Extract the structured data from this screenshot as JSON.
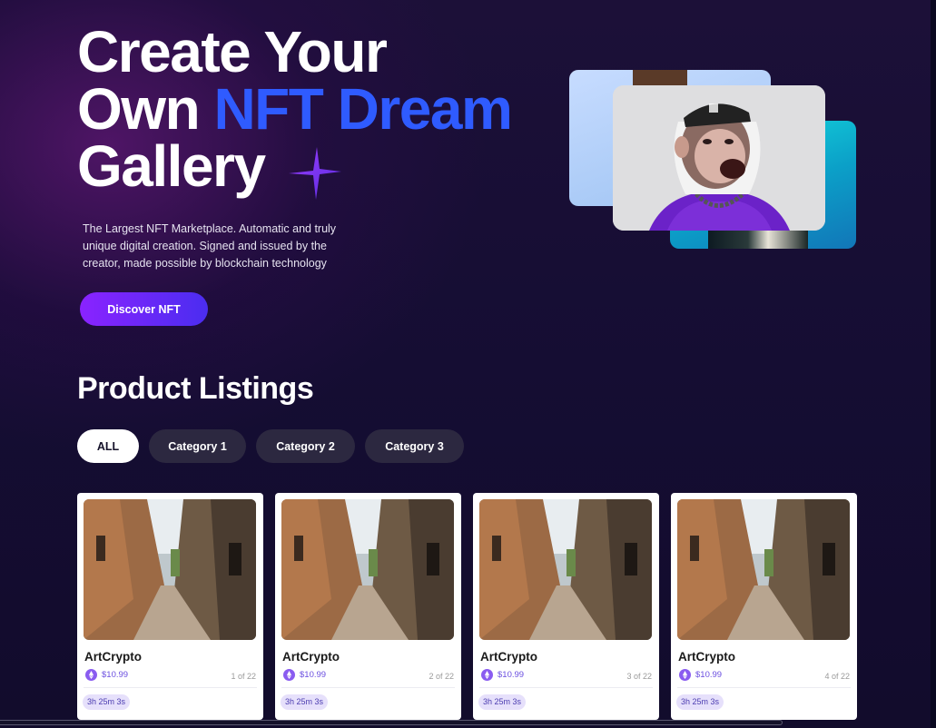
{
  "hero": {
    "title_line1": "Create Your",
    "title_line2_a": "Own ",
    "title_line2_b": "NFT Dream",
    "title_line3": "Gallery",
    "description": "The Largest NFT Marketplace. Automatic and truly unique digital creation. Signed and issued by the creator, made possible by blockchain technology",
    "cta_label": "Discover NFT",
    "sparkle_icon": "sparkle-icon",
    "artwork": "ape-nft-artwork"
  },
  "listings": {
    "title": "Product Listings",
    "filters": [
      {
        "label": "ALL",
        "active": true
      },
      {
        "label": "Category 1",
        "active": false
      },
      {
        "label": "Category 2",
        "active": false
      },
      {
        "label": "Category 3",
        "active": false
      }
    ],
    "cards": [
      {
        "name": "ArtCrypto",
        "price": "$10.99",
        "count": "1 of 22",
        "timer": "3h 25m 3s"
      },
      {
        "name": "ArtCrypto",
        "price": "$10.99",
        "count": "2 of 22",
        "timer": "3h 25m 3s"
      },
      {
        "name": "ArtCrypto",
        "price": "$10.99",
        "count": "3 of 22",
        "timer": "3h 25m 3s"
      },
      {
        "name": "ArtCrypto",
        "price": "$10.99",
        "count": "4 of 22",
        "timer": "3h 25m 3s"
      }
    ]
  },
  "colors": {
    "background": "#110c2a",
    "accent_blue": "#2f5bff",
    "cta_gradient_start": "#8a23ff",
    "cta_gradient_end": "#4b2df0",
    "chip_inactive": "#2c2840",
    "timer_badge": "#e6e0fb"
  }
}
